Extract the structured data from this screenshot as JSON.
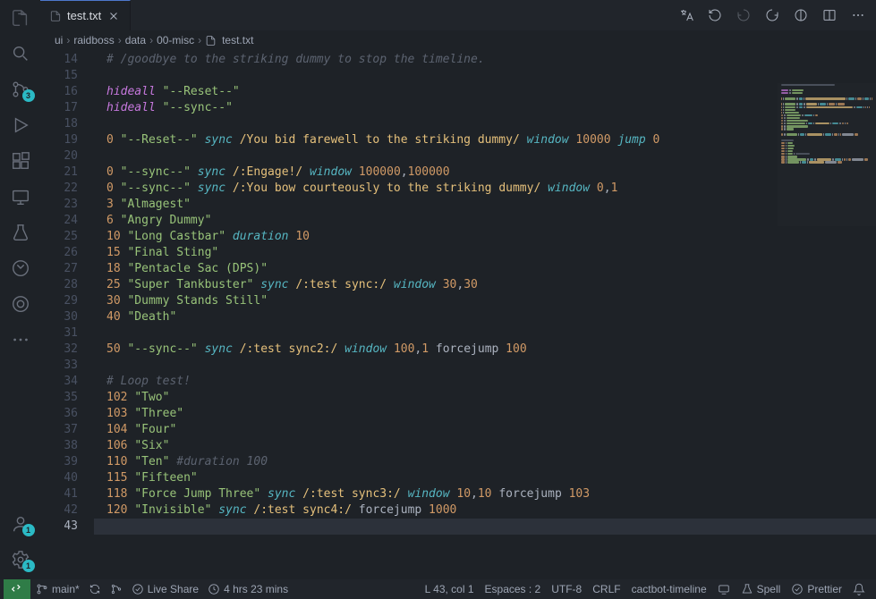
{
  "tab": {
    "filename": "test.txt"
  },
  "breadcrumbs": [
    "ui",
    "raidboss",
    "data",
    "00-misc",
    "test.txt"
  ],
  "activity": {
    "sourcecontrol_badge": "3",
    "accounts_badge": "1",
    "settings_badge": "1"
  },
  "gutter": {
    "start": 14,
    "end": 43,
    "current": 43
  },
  "lines": [
    [
      [
        "comment",
        "# /goodbye to the striking dummy to stop the timeline."
      ]
    ],
    [],
    [
      [
        "kw",
        "hideall"
      ],
      [
        "plain",
        " "
      ],
      [
        "str",
        "\"--Reset--\""
      ]
    ],
    [
      [
        "kw",
        "hideall"
      ],
      [
        "plain",
        " "
      ],
      [
        "str",
        "\"--sync--\""
      ]
    ],
    [],
    [
      [
        "num",
        "0"
      ],
      [
        "plain",
        " "
      ],
      [
        "str",
        "\"--Reset--\""
      ],
      [
        "plain",
        " "
      ],
      [
        "kw2",
        "sync"
      ],
      [
        "plain",
        " "
      ],
      [
        "regex",
        "/You bid farewell to the striking dummy/"
      ],
      [
        "plain",
        " "
      ],
      [
        "kw2",
        "window"
      ],
      [
        "plain",
        " "
      ],
      [
        "num",
        "10000"
      ],
      [
        "plain",
        " "
      ],
      [
        "kw2",
        "jump"
      ],
      [
        "plain",
        " "
      ],
      [
        "num",
        "0"
      ]
    ],
    [],
    [
      [
        "num",
        "0"
      ],
      [
        "plain",
        " "
      ],
      [
        "str",
        "\"--sync--\""
      ],
      [
        "plain",
        " "
      ],
      [
        "kw2",
        "sync"
      ],
      [
        "plain",
        " "
      ],
      [
        "regex",
        "/:Engage!/"
      ],
      [
        "plain",
        " "
      ],
      [
        "kw2",
        "window"
      ],
      [
        "plain",
        " "
      ],
      [
        "num",
        "100000"
      ],
      [
        "plain",
        ","
      ],
      [
        "num",
        "100000"
      ]
    ],
    [
      [
        "num",
        "0"
      ],
      [
        "plain",
        " "
      ],
      [
        "str",
        "\"--sync--\""
      ],
      [
        "plain",
        " "
      ],
      [
        "kw2",
        "sync"
      ],
      [
        "plain",
        " "
      ],
      [
        "regex",
        "/:You bow courteously to the striking dummy/"
      ],
      [
        "plain",
        " "
      ],
      [
        "kw2",
        "window"
      ],
      [
        "plain",
        " "
      ],
      [
        "num",
        "0"
      ],
      [
        "plain",
        ","
      ],
      [
        "num",
        "1"
      ]
    ],
    [
      [
        "num",
        "3"
      ],
      [
        "plain",
        " "
      ],
      [
        "str",
        "\"Almagest\""
      ]
    ],
    [
      [
        "num",
        "6"
      ],
      [
        "plain",
        " "
      ],
      [
        "str",
        "\"Angry Dummy\""
      ]
    ],
    [
      [
        "num",
        "10"
      ],
      [
        "plain",
        " "
      ],
      [
        "str",
        "\"Long Castbar\""
      ],
      [
        "plain",
        " "
      ],
      [
        "kw2",
        "duration"
      ],
      [
        "plain",
        " "
      ],
      [
        "num",
        "10"
      ]
    ],
    [
      [
        "num",
        "15"
      ],
      [
        "plain",
        " "
      ],
      [
        "str",
        "\"Final Sting\""
      ]
    ],
    [
      [
        "num",
        "18"
      ],
      [
        "plain",
        " "
      ],
      [
        "str",
        "\"Pentacle Sac (DPS)\""
      ]
    ],
    [
      [
        "num",
        "25"
      ],
      [
        "plain",
        " "
      ],
      [
        "str",
        "\"Super Tankbuster\""
      ],
      [
        "plain",
        " "
      ],
      [
        "kw2",
        "sync"
      ],
      [
        "plain",
        " "
      ],
      [
        "regex",
        "/:test sync:/"
      ],
      [
        "plain",
        " "
      ],
      [
        "kw2",
        "window"
      ],
      [
        "plain",
        " "
      ],
      [
        "num",
        "30"
      ],
      [
        "plain",
        ","
      ],
      [
        "num",
        "30"
      ]
    ],
    [
      [
        "num",
        "30"
      ],
      [
        "plain",
        " "
      ],
      [
        "str",
        "\"Dummy Stands Still\""
      ]
    ],
    [
      [
        "num",
        "40"
      ],
      [
        "plain",
        " "
      ],
      [
        "str",
        "\"Death\""
      ]
    ],
    [],
    [
      [
        "num",
        "50"
      ],
      [
        "plain",
        " "
      ],
      [
        "str",
        "\"--sync--\""
      ],
      [
        "plain",
        " "
      ],
      [
        "kw2",
        "sync"
      ],
      [
        "plain",
        " "
      ],
      [
        "regex",
        "/:test sync2:/"
      ],
      [
        "plain",
        " "
      ],
      [
        "kw2",
        "window"
      ],
      [
        "plain",
        " "
      ],
      [
        "num",
        "100"
      ],
      [
        "plain",
        ","
      ],
      [
        "num",
        "1"
      ],
      [
        "plain",
        " forcejump "
      ],
      [
        "num",
        "100"
      ]
    ],
    [],
    [
      [
        "comment",
        "# Loop test!"
      ]
    ],
    [
      [
        "num",
        "102"
      ],
      [
        "plain",
        " "
      ],
      [
        "str",
        "\"Two\""
      ]
    ],
    [
      [
        "num",
        "103"
      ],
      [
        "plain",
        " "
      ],
      [
        "str",
        "\"Three\""
      ]
    ],
    [
      [
        "num",
        "104"
      ],
      [
        "plain",
        " "
      ],
      [
        "str",
        "\"Four\""
      ]
    ],
    [
      [
        "num",
        "106"
      ],
      [
        "plain",
        " "
      ],
      [
        "str",
        "\"Six\""
      ]
    ],
    [
      [
        "num",
        "110"
      ],
      [
        "plain",
        " "
      ],
      [
        "str",
        "\"Ten\""
      ],
      [
        "plain",
        " "
      ],
      [
        "comment",
        "#duration 100"
      ]
    ],
    [
      [
        "num",
        "115"
      ],
      [
        "plain",
        " "
      ],
      [
        "str",
        "\"Fifteen\""
      ]
    ],
    [
      [
        "num",
        "118"
      ],
      [
        "plain",
        " "
      ],
      [
        "str",
        "\"Force Jump Three\""
      ],
      [
        "plain",
        " "
      ],
      [
        "kw2",
        "sync"
      ],
      [
        "plain",
        " "
      ],
      [
        "regex",
        "/:test sync3:/"
      ],
      [
        "plain",
        " "
      ],
      [
        "kw2",
        "window"
      ],
      [
        "plain",
        " "
      ],
      [
        "num",
        "10"
      ],
      [
        "plain",
        ","
      ],
      [
        "num",
        "10"
      ],
      [
        "plain",
        " forcejump "
      ],
      [
        "num",
        "103"
      ]
    ],
    [
      [
        "num",
        "120"
      ],
      [
        "plain",
        " "
      ],
      [
        "str",
        "\"Invisible\""
      ],
      [
        "plain",
        " "
      ],
      [
        "kw2",
        "sync"
      ],
      [
        "plain",
        " "
      ],
      [
        "regex",
        "/:test sync4:/"
      ],
      [
        "plain",
        " forcejump "
      ],
      [
        "num",
        "1000"
      ]
    ],
    []
  ],
  "status": {
    "branch": "main*",
    "liveshare": "Live Share",
    "time": "4 hrs 23 mins",
    "cursor": "L 43, col 1",
    "spaces": "Espaces : 2",
    "encoding": "UTF-8",
    "eol": "CRLF",
    "lang": "cactbot-timeline",
    "spell": "Spell",
    "prettier": "Prettier"
  }
}
